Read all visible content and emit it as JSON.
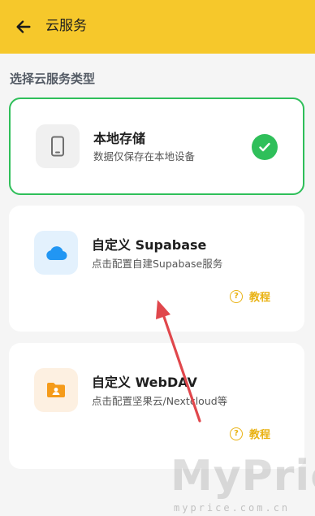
{
  "header": {
    "title": "云服务"
  },
  "section": {
    "title": "选择云服务类型"
  },
  "options": [
    {
      "title": "本地存储",
      "description": "数据仅保存在本地设备",
      "icon": "phone-icon",
      "selected": true
    },
    {
      "title": "自定义 Supabase",
      "description": "点击配置自建Supabase服务",
      "icon": "cloud-icon",
      "tutorial": "教程"
    },
    {
      "title": "自定义 WebDAV",
      "description": "点击配置坚果云/Nextcloud等",
      "icon": "folder-user-icon",
      "tutorial": "教程"
    }
  ],
  "watermark": {
    "brand": "MyPrice",
    "domain": "myprice.com.cn"
  },
  "colors": {
    "header": "#f6c82b",
    "selected": "#2fbf5a",
    "accent": "#e9b213",
    "annotation": "#e0474c"
  }
}
